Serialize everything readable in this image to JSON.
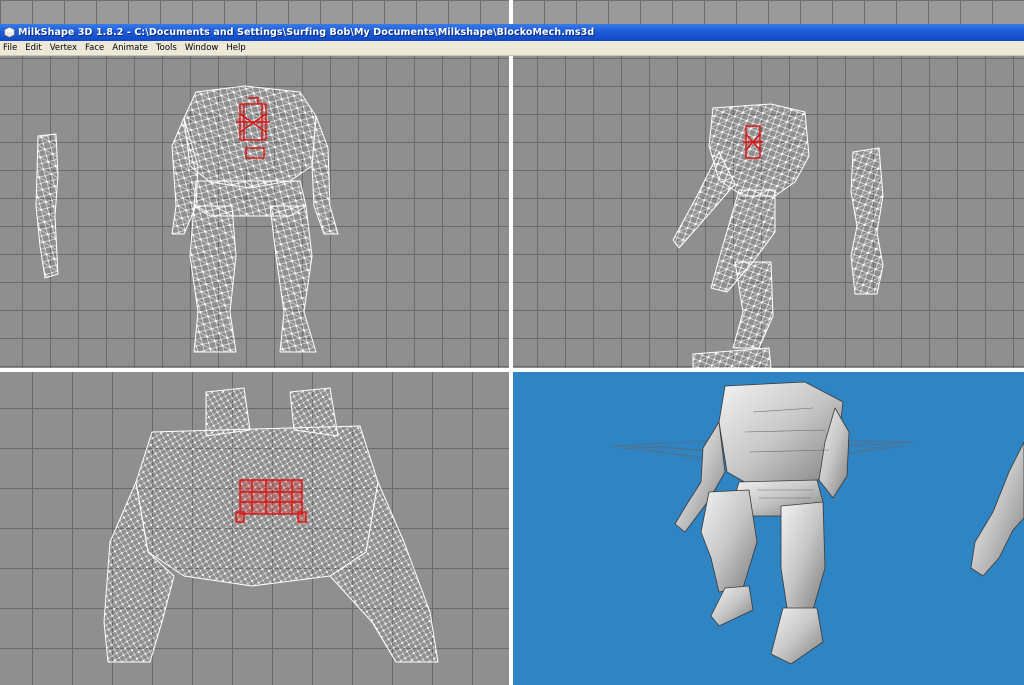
{
  "window": {
    "title": "MilkShape 3D 1.8.2 - C:\\Documents and Settings\\Surfing Bob\\My Documents\\Milkshape\\BlockoMech.ms3d",
    "icon": "milkshape-app-icon"
  },
  "menu": {
    "items": [
      "File",
      "Edit",
      "Vertex",
      "Face",
      "Animate",
      "Tools",
      "Window",
      "Help"
    ]
  },
  "viewports": {
    "front": {
      "view": "front",
      "wire_color": "#ffffff",
      "selection_color": "#e01010"
    },
    "side": {
      "view": "left",
      "wire_color": "#ffffff",
      "selection_color": "#e01010"
    },
    "top": {
      "view": "top",
      "wire_color": "#ffffff",
      "selection_color": "#e01010"
    },
    "perspective": {
      "view": "3d",
      "background": "#2f84c4",
      "model_color": "#c8c8c8"
    }
  },
  "colors": {
    "titlebar": "#1f5fd8",
    "menubar": "#ece9d8",
    "grid_bg": "#8f8f8f",
    "grid_line": "#6a6a6a"
  }
}
